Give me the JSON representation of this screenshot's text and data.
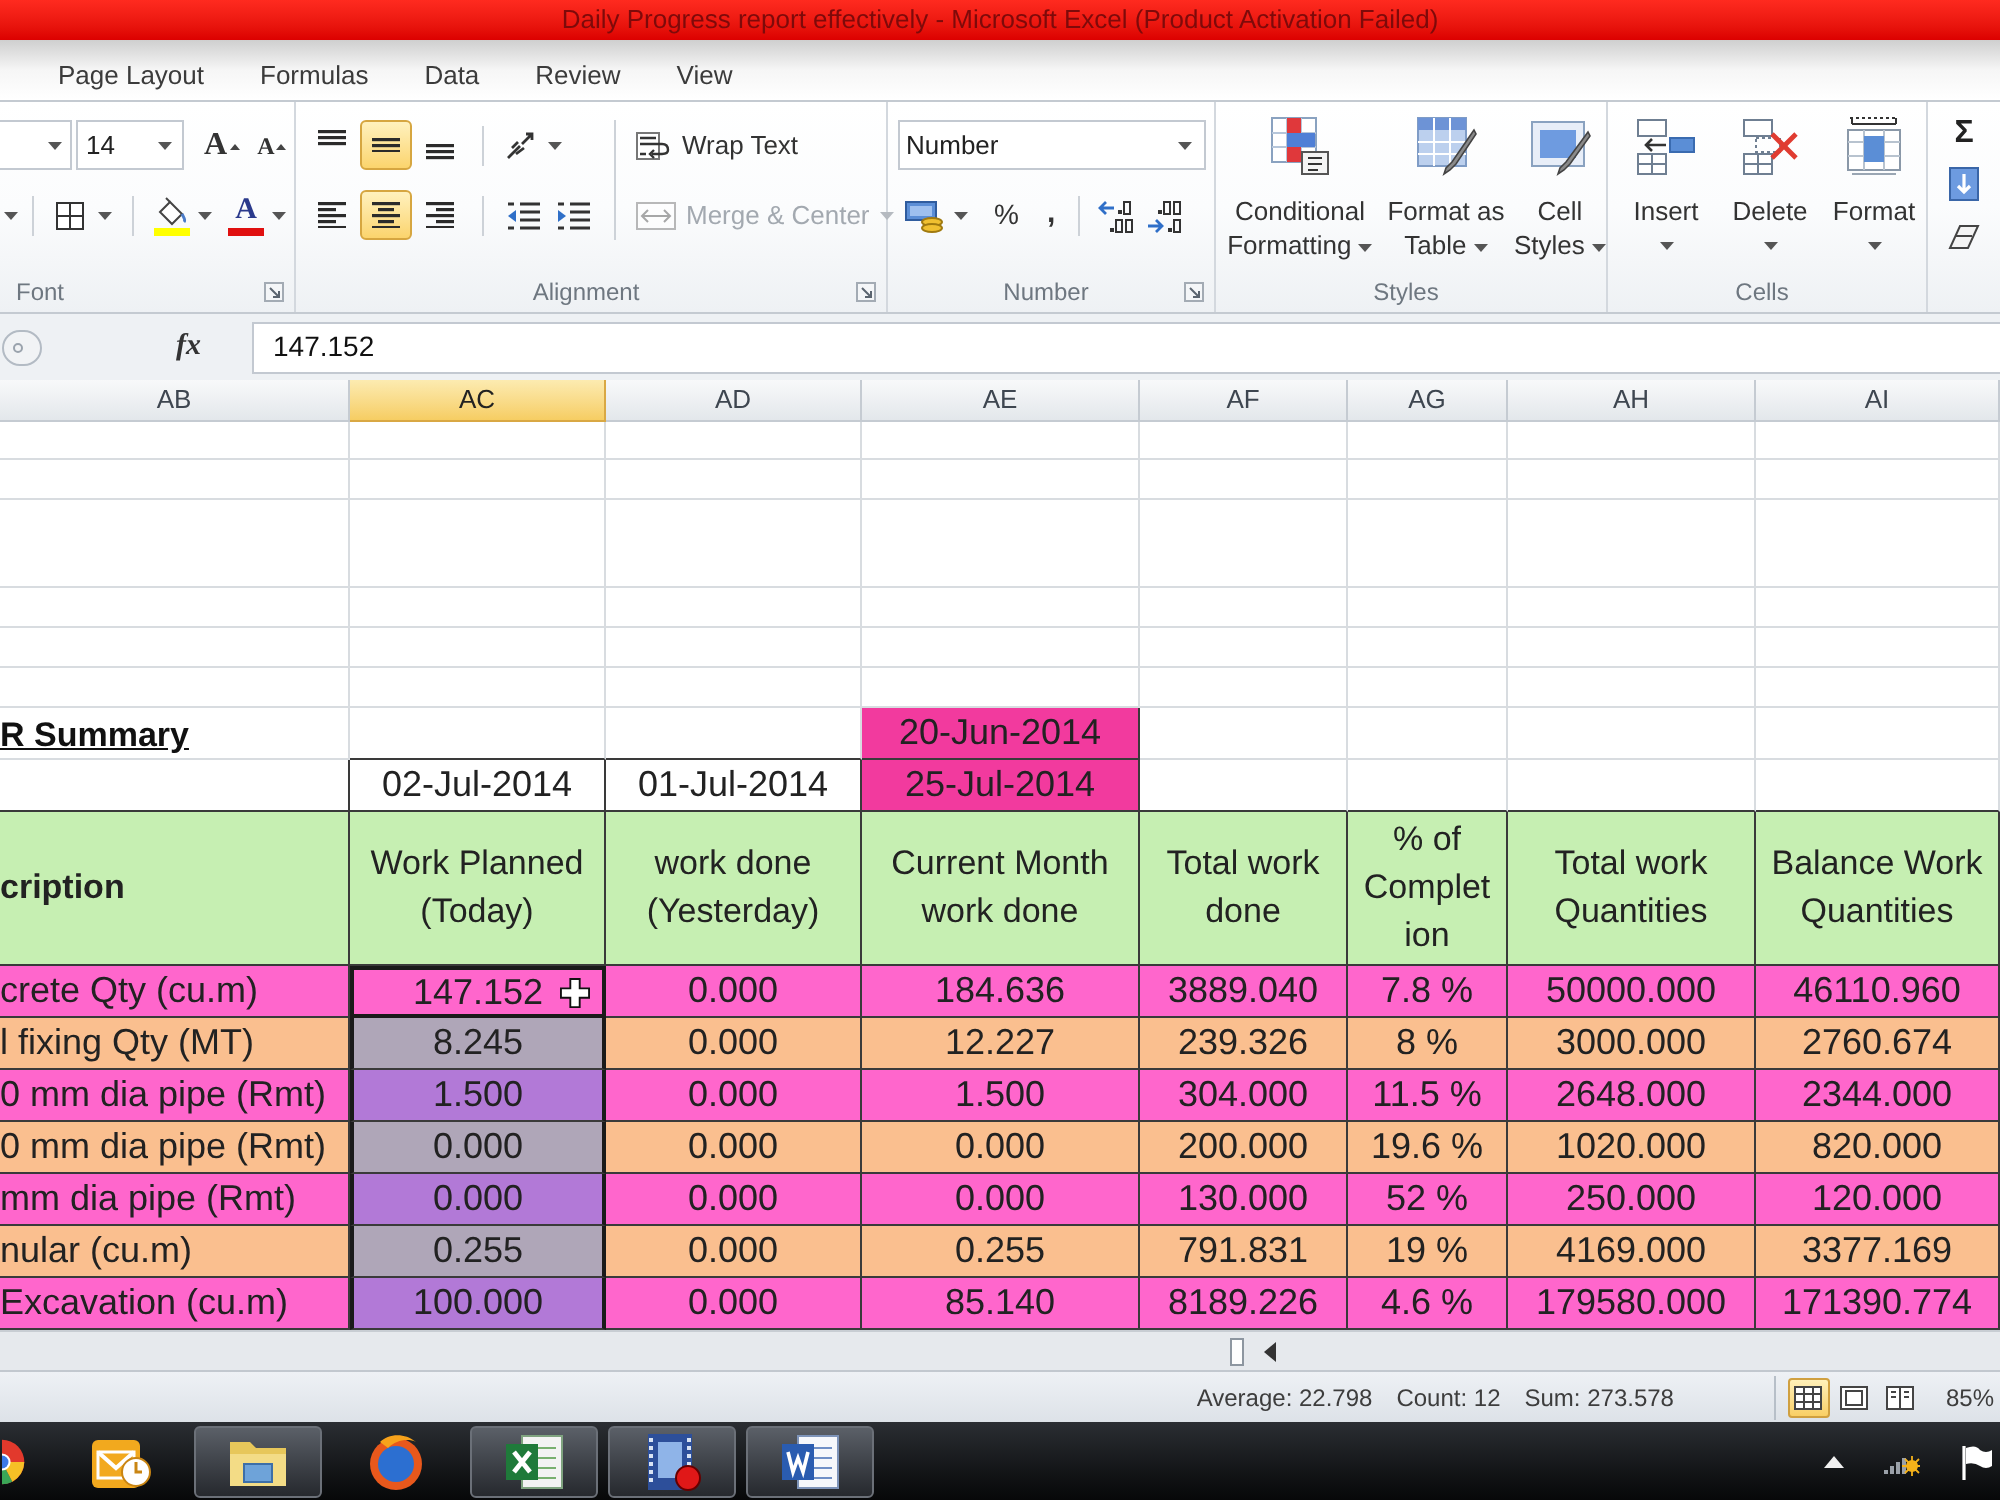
{
  "window": {
    "title": "Daily Progress report effectively - Microsoft Excel (Product Activation Failed)"
  },
  "ribbon_tabs": [
    {
      "label": "Page Layout",
      "selected": false
    },
    {
      "label": "Formulas",
      "selected": false
    },
    {
      "label": "Data",
      "selected": false
    },
    {
      "label": "Review",
      "selected": false
    },
    {
      "label": "View",
      "selected": false
    }
  ],
  "ribbon": {
    "font": {
      "label": "Font",
      "size": "14",
      "grow_font": "A",
      "shrink_font": "A",
      "font_color": "A"
    },
    "alignment": {
      "label": "Alignment",
      "vertical": [
        {
          "kind": "top",
          "selected": false
        },
        {
          "kind": "middle",
          "selected": true
        },
        {
          "kind": "bottom",
          "selected": false
        }
      ],
      "horizontal": [
        {
          "kind": "left",
          "selected": false
        },
        {
          "kind": "center",
          "selected": true
        },
        {
          "kind": "right",
          "selected": false
        }
      ],
      "wrap_text": {
        "label": "Wrap Text",
        "disabled": false
      },
      "merge_center": {
        "label": "Merge & Center",
        "disabled": true
      }
    },
    "number": {
      "label": "Number",
      "format": "Number",
      "percent": "%",
      "comma": ","
    },
    "styles": {
      "label": "Styles",
      "buttons": [
        {
          "kind": "conditional",
          "label": "Conditional Formatting"
        },
        {
          "kind": "table",
          "label": "Format as Table"
        },
        {
          "kind": "cell",
          "label": "Cell Styles"
        }
      ]
    },
    "cells": {
      "label": "Cells",
      "buttons": [
        {
          "kind": "insert",
          "label": "Insert"
        },
        {
          "kind": "delete",
          "label": "Delete"
        },
        {
          "kind": "format",
          "label": "Format"
        }
      ]
    },
    "editing": {
      "autosum": "Σ"
    }
  },
  "formula_bar": {
    "function_label": "fx",
    "value": "147.152"
  },
  "columns": [
    {
      "label": "AB",
      "selected": false
    },
    {
      "label": "AC",
      "selected": true
    },
    {
      "label": "AD",
      "selected": false
    },
    {
      "label": "AE",
      "selected": false
    },
    {
      "label": "AF",
      "selected": false
    },
    {
      "label": "AG",
      "selected": false
    },
    {
      "label": "AH",
      "selected": false
    },
    {
      "label": "AI",
      "selected": false
    }
  ],
  "sheet": {
    "summary_title": "R Summary",
    "period_start": "20-Jun-2014",
    "period_end": "25-Jul-2014",
    "dates": [
      "02-Jul-2014",
      "01-Jul-2014"
    ],
    "headers": [
      "cription",
      "Work Planned (Today)",
      "work done (Yesterday)",
      "Current Month work done",
      "Total work done",
      "% of Complet ion",
      "Total work Quantities",
      "Balance Work Quantities"
    ],
    "rows": [
      {
        "color": "#ff66cc",
        "cells": [
          {
            "text": "crete Qty (cu.m)",
            "selected": false,
            "active": false
          },
          {
            "text": "147.152",
            "selected": true,
            "active": true
          },
          {
            "text": "0.000",
            "selected": false,
            "active": false
          },
          {
            "text": "184.636",
            "selected": false,
            "active": false
          },
          {
            "text": "3889.040",
            "selected": false,
            "active": false
          },
          {
            "text": "7.8 %",
            "selected": false,
            "active": false
          },
          {
            "text": "50000.000",
            "selected": false,
            "active": false
          },
          {
            "text": "46110.960",
            "selected": false,
            "active": false
          }
        ]
      },
      {
        "color": "#fabf8f",
        "cells": [
          {
            "text": "l fixing Qty (MT)",
            "selected": false,
            "active": false
          },
          {
            "text": "8.245",
            "selected": true,
            "active": false
          },
          {
            "text": "0.000",
            "selected": false,
            "active": false
          },
          {
            "text": "12.227",
            "selected": false,
            "active": false
          },
          {
            "text": "239.326",
            "selected": false,
            "active": false
          },
          {
            "text": "8 %",
            "selected": false,
            "active": false
          },
          {
            "text": "3000.000",
            "selected": false,
            "active": false
          },
          {
            "text": "2760.674",
            "selected": false,
            "active": false
          }
        ]
      },
      {
        "color": "#ff66cc",
        "cells": [
          {
            "text": "0 mm dia pipe (Rmt)",
            "selected": false,
            "active": false
          },
          {
            "text": "1.500",
            "selected": true,
            "active": false
          },
          {
            "text": "0.000",
            "selected": false,
            "active": false
          },
          {
            "text": "1.500",
            "selected": false,
            "active": false
          },
          {
            "text": "304.000",
            "selected": false,
            "active": false
          },
          {
            "text": "11.5 %",
            "selected": false,
            "active": false
          },
          {
            "text": "2648.000",
            "selected": false,
            "active": false
          },
          {
            "text": "2344.000",
            "selected": false,
            "active": false
          }
        ]
      },
      {
        "color": "#fabf8f",
        "cells": [
          {
            "text": "0 mm dia pipe (Rmt)",
            "selected": false,
            "active": false
          },
          {
            "text": "0.000",
            "selected": true,
            "active": false
          },
          {
            "text": "0.000",
            "selected": false,
            "active": false
          },
          {
            "text": "0.000",
            "selected": false,
            "active": false
          },
          {
            "text": "200.000",
            "selected": false,
            "active": false
          },
          {
            "text": "19.6 %",
            "selected": false,
            "active": false
          },
          {
            "text": "1020.000",
            "selected": false,
            "active": false
          },
          {
            "text": "820.000",
            "selected": false,
            "active": false
          }
        ]
      },
      {
        "color": "#ff66cc",
        "cells": [
          {
            "text": "mm dia pipe (Rmt)",
            "selected": false,
            "active": false
          },
          {
            "text": "0.000",
            "selected": true,
            "active": false
          },
          {
            "text": "0.000",
            "selected": false,
            "active": false
          },
          {
            "text": "0.000",
            "selected": false,
            "active": false
          },
          {
            "text": "130.000",
            "selected": false,
            "active": false
          },
          {
            "text": "52 %",
            "selected": false,
            "active": false
          },
          {
            "text": "250.000",
            "selected": false,
            "active": false
          },
          {
            "text": "120.000",
            "selected": false,
            "active": false
          }
        ]
      },
      {
        "color": "#fabf8f",
        "cells": [
          {
            "text": "nular (cu.m)",
            "selected": false,
            "active": false
          },
          {
            "text": "0.255",
            "selected": true,
            "active": false
          },
          {
            "text": "0.000",
            "selected": false,
            "active": false
          },
          {
            "text": "0.255",
            "selected": false,
            "active": false
          },
          {
            "text": "791.831",
            "selected": false,
            "active": false
          },
          {
            "text": "19 %",
            "selected": false,
            "active": false
          },
          {
            "text": "4169.000",
            "selected": false,
            "active": false
          },
          {
            "text": "3377.169",
            "selected": false,
            "active": false
          }
        ]
      },
      {
        "color": "#ff66cc",
        "cells": [
          {
            "text": "Excavation (cu.m)",
            "selected": false,
            "active": false
          },
          {
            "text": "100.000",
            "selected": true,
            "active": false
          },
          {
            "text": "0.000",
            "selected": false,
            "active": false
          },
          {
            "text": "85.140",
            "selected": false,
            "active": false
          },
          {
            "text": "8189.226",
            "selected": false,
            "active": false
          },
          {
            "text": "4.6 %",
            "selected": false,
            "active": false
          },
          {
            "text": "179580.000",
            "selected": false,
            "active": false
          },
          {
            "text": "171390.774",
            "selected": false,
            "active": false
          }
        ]
      }
    ]
  },
  "status_bar": {
    "average": "Average: 22.798",
    "count": "Count: 12",
    "sum": "Sum: 273.578",
    "views": [
      {
        "kind": "normal",
        "selected": true
      },
      {
        "kind": "page_layout",
        "selected": false
      },
      {
        "kind": "page_break",
        "selected": false
      }
    ],
    "zoom": "85%"
  },
  "taskbar": {
    "apps": [
      {
        "kind": "round",
        "running": false
      },
      {
        "kind": "mail",
        "running": false
      },
      {
        "kind": "folder",
        "running": true
      },
      {
        "kind": "flame",
        "running": false
      },
      {
        "kind": "spreadsheet",
        "running": true
      },
      {
        "kind": "video",
        "running": true
      },
      {
        "kind": "document",
        "running": true
      }
    ]
  }
}
